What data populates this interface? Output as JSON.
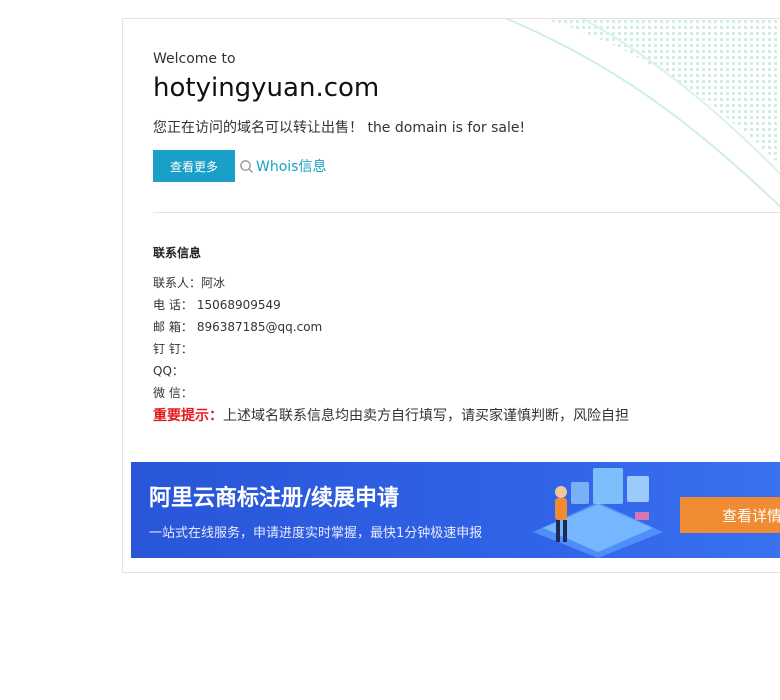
{
  "welcome": "Welcome to",
  "domain": "hotyingyuan.com",
  "sale_text": "您正在访问的域名可以转让出售！ the domain is for sale!",
  "buttons": {
    "more": "查看更多",
    "whois": "Whois信息"
  },
  "contact": {
    "title": "联系信息",
    "rows": [
      {
        "label": "联系人：",
        "value": "阿冰"
      },
      {
        "label": "电 话：",
        "value": "15068909549"
      },
      {
        "label": "邮 箱：",
        "value": "896387185@qq.com"
      },
      {
        "label": "钉 钉：",
        "value": ""
      },
      {
        "label": "QQ：",
        "value": ""
      },
      {
        "label": "微 信：",
        "value": ""
      }
    ]
  },
  "notice": {
    "label": "重要提示：",
    "text": "上述域名联系信息均由卖方自行填写，请买家谨慎判断，风险自担"
  },
  "banner": {
    "title": "阿里云商标注册/续展申请",
    "subtitle": "一站式在线服务，申请进度实时掌握，最快1分钟极速申报",
    "cta": "查看详情"
  },
  "colors": {
    "accent": "#1aa0c8",
    "warning": "#e31b1b",
    "banner": "#2f62e6",
    "cta": "#f08a33"
  }
}
